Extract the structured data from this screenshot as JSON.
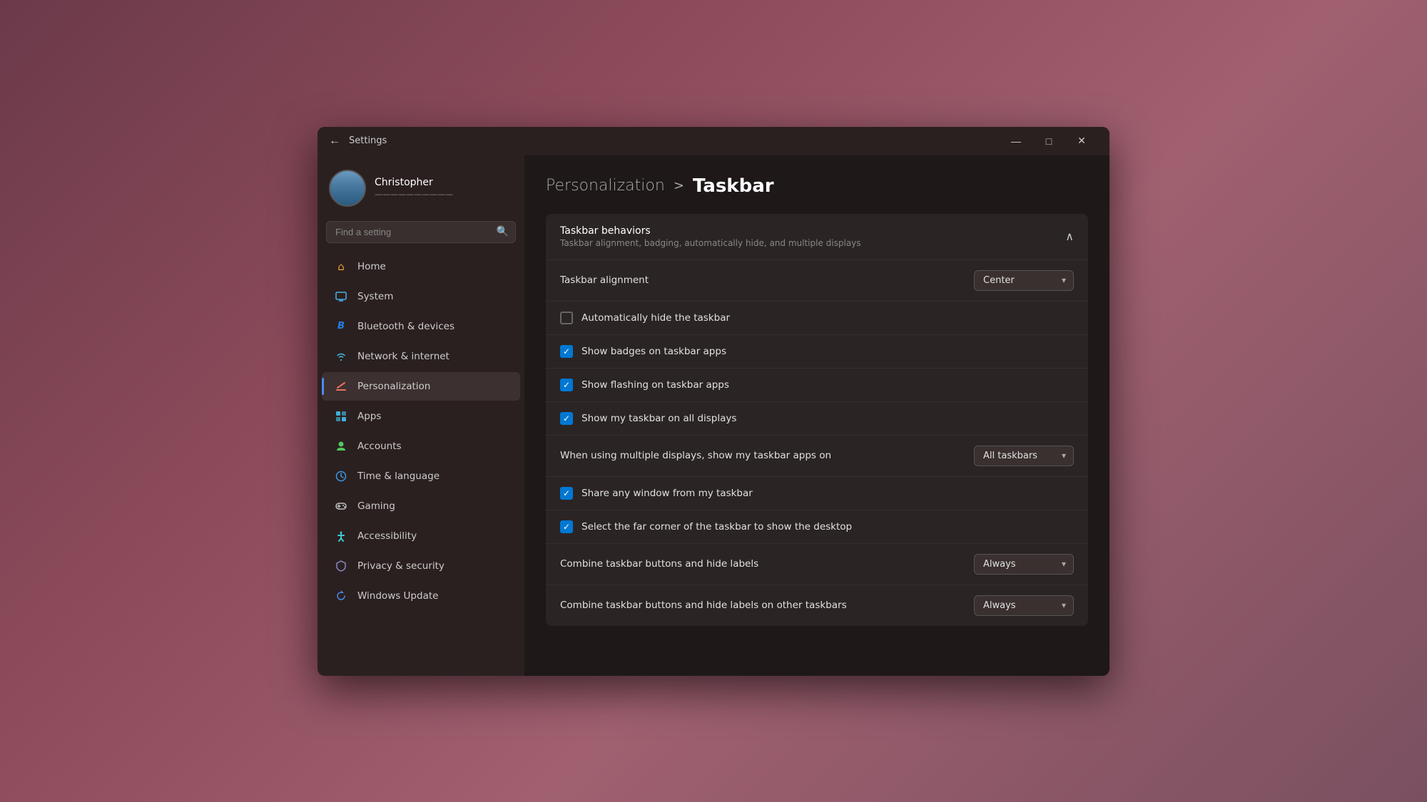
{
  "window": {
    "title": "Settings"
  },
  "titlebar": {
    "back_label": "←",
    "title": "Settings",
    "minimize": "—",
    "maximize": "□",
    "close": "✕"
  },
  "user": {
    "name": "Christopher",
    "subtitle": "——————————"
  },
  "search": {
    "placeholder": "Find a setting"
  },
  "nav": {
    "items": [
      {
        "id": "home",
        "label": "Home",
        "icon": "🏠"
      },
      {
        "id": "system",
        "label": "System",
        "icon": "💻"
      },
      {
        "id": "bluetooth",
        "label": "Bluetooth & devices",
        "icon": "B"
      },
      {
        "id": "network",
        "label": "Network & internet",
        "icon": "📶"
      },
      {
        "id": "personalization",
        "label": "Personalization",
        "icon": "✏️"
      },
      {
        "id": "apps",
        "label": "Apps",
        "icon": "📦"
      },
      {
        "id": "accounts",
        "label": "Accounts",
        "icon": "👤"
      },
      {
        "id": "time",
        "label": "Time & language",
        "icon": "🕐"
      },
      {
        "id": "gaming",
        "label": "Gaming",
        "icon": "🎮"
      },
      {
        "id": "accessibility",
        "label": "Accessibility",
        "icon": "♿"
      },
      {
        "id": "privacy",
        "label": "Privacy & security",
        "icon": "🛡"
      },
      {
        "id": "update",
        "label": "Windows Update",
        "icon": "🔄"
      }
    ]
  },
  "breadcrumb": {
    "parent": "Personalization",
    "separator": ">",
    "current": "Taskbar"
  },
  "section": {
    "title": "Taskbar behaviors",
    "subtitle": "Taskbar alignment, badging, automatically hide, and multiple displays"
  },
  "settings": [
    {
      "type": "dropdown",
      "label": "Taskbar alignment",
      "value": "Center"
    },
    {
      "type": "checkbox",
      "label": "Automatically hide the taskbar",
      "checked": false
    },
    {
      "type": "checkbox",
      "label": "Show badges on taskbar apps",
      "checked": true
    },
    {
      "type": "checkbox",
      "label": "Show flashing on taskbar apps",
      "checked": true
    },
    {
      "type": "checkbox",
      "label": "Show my taskbar on all displays",
      "checked": true
    },
    {
      "type": "dropdown",
      "label": "When using multiple displays, show my taskbar apps on",
      "value": "All taskbars"
    },
    {
      "type": "checkbox",
      "label": "Share any window from my taskbar",
      "checked": true
    },
    {
      "type": "checkbox",
      "label": "Select the far corner of the taskbar to show the desktop",
      "checked": true
    },
    {
      "type": "dropdown",
      "label": "Combine taskbar buttons and hide labels",
      "value": "Always"
    },
    {
      "type": "dropdown",
      "label": "Combine taskbar buttons and hide labels on other taskbars",
      "value": "Always"
    }
  ]
}
